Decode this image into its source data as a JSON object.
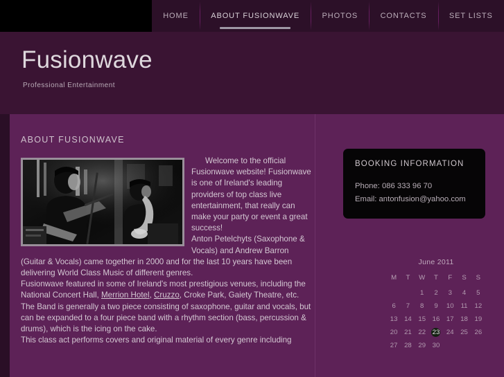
{
  "nav": {
    "items": [
      {
        "label": "HOME",
        "active": false
      },
      {
        "label": "ABOUT FUSIONWAVE",
        "active": true
      },
      {
        "label": "PHOTOS",
        "active": false
      },
      {
        "label": "CONTACTS",
        "active": false
      },
      {
        "label": "SET LISTS",
        "active": false
      }
    ]
  },
  "hero": {
    "title": "Fusionwave",
    "tagline": "Professional Entertainment"
  },
  "main": {
    "heading": "ABOUT FUSIONWAVE",
    "photo_alt": "band-photo-saxophone-guitar",
    "paragraphs": {
      "p1": "Welcome to the official Fusionwave website! Fusionwave is one of Ireland's leading providers of top class live entertainment, that really can make your party or event a great success!",
      "p2_a": "Anton Petelchyts (Saxophone & Vocals) and Andrew Barron (Guitar & Vocals) came together in 2000 and for the last 10 years have been delivering World Class Music of different genres.",
      "p3_pre": "Fusionwave featured in some of Ireland's most prestigious venues, including the National Concert Hall, ",
      "p3_link1": "Merrion Hotel",
      "p3_mid": ", ",
      "p3_link2": "Cruzzo",
      "p3_post": ", Croke Park, Gaiety Theatre, etc.",
      "p4": "The Band is generally a two piece consisting of saxophone, guitar and vocals, but can be expanded to a four piece band with a rhythm section (bass, percussion & drums), which is the icing on the cake.",
      "p5": "This class act performs covers and original material of every genre including"
    }
  },
  "booking": {
    "title": "BOOKING INFORMATION",
    "phone": "Phone: 086 333 96 70",
    "email": "Email:  antonfusion@yahoo.com"
  },
  "calendar": {
    "caption": "June 2011",
    "weekdays": [
      "M",
      "T",
      "W",
      "T",
      "F",
      "S",
      "S"
    ],
    "today": "23",
    "weeks": [
      [
        "",
        "",
        "1",
        "2",
        "3",
        "4",
        "5"
      ],
      [
        "6",
        "7",
        "8",
        "9",
        "10",
        "11",
        "12"
      ],
      [
        "13",
        "14",
        "15",
        "16",
        "17",
        "18",
        "19"
      ],
      [
        "20",
        "21",
        "22",
        "23",
        "24",
        "25",
        "26"
      ],
      [
        "27",
        "28",
        "29",
        "30",
        "",
        "",
        ""
      ]
    ]
  },
  "colors": {
    "topbar": "#2c1028",
    "hero": "#3a1433",
    "page_bg": "#2a0f26",
    "content_bg": "#5d2257",
    "booking_bg": "#060506",
    "today_bg": "#132111"
  }
}
